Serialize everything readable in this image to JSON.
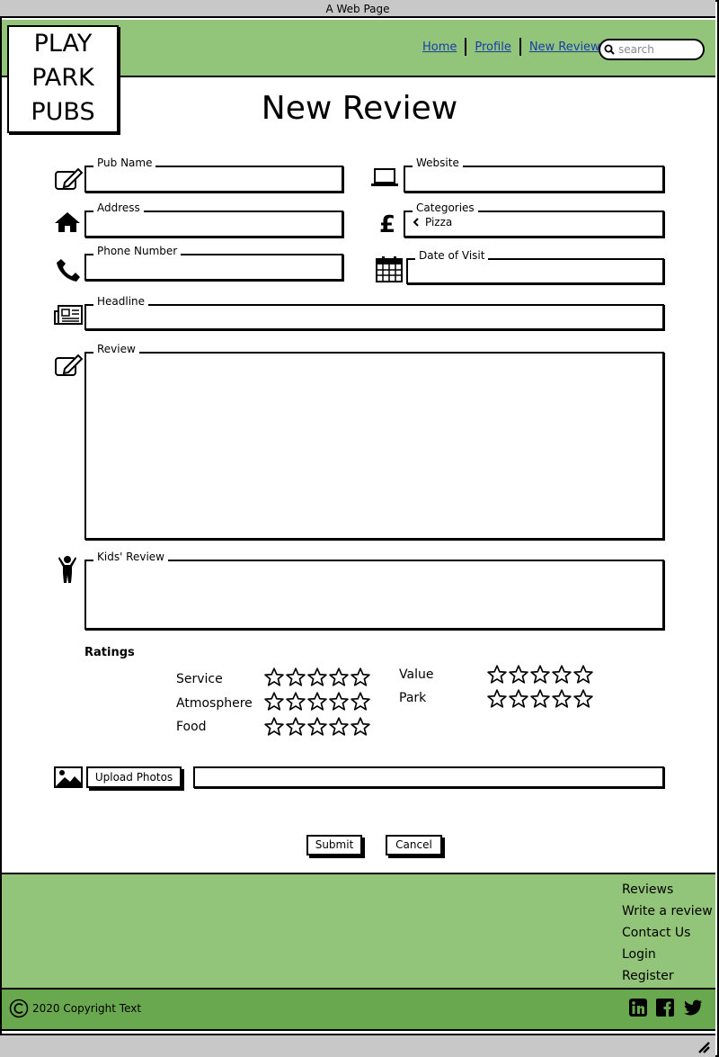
{
  "window": {
    "title": "A Web Page"
  },
  "logo": {
    "line1": "PLAY",
    "line2": "PARK",
    "line3": "PUBS"
  },
  "nav": {
    "home": "Home",
    "profile": "Profile",
    "new_review": "New Review"
  },
  "search": {
    "placeholder": "search"
  },
  "page": {
    "title": "New Review"
  },
  "form": {
    "pub_name": {
      "label": "Pub Name",
      "value": ""
    },
    "website": {
      "label": "Website",
      "value": ""
    },
    "address": {
      "label": "Address",
      "value": ""
    },
    "categories": {
      "label": "Categories",
      "value": "Pizza"
    },
    "phone": {
      "label": "Phone Number",
      "value": ""
    },
    "date_of_visit": {
      "label": "Date of Visit",
      "value": ""
    },
    "headline": {
      "label": "Headline",
      "value": ""
    },
    "review": {
      "label": "Review",
      "value": ""
    },
    "kids_review": {
      "label": "Kids' Review",
      "value": ""
    }
  },
  "ratings": {
    "title": "Ratings",
    "service": {
      "label": "Service",
      "stars": 0
    },
    "atmosphere": {
      "label": "Atmosphere",
      "stars": 0
    },
    "food": {
      "label": "Food",
      "stars": 0
    },
    "value": {
      "label": "Value",
      "stars": 0
    },
    "park": {
      "label": "Park",
      "stars": 0
    }
  },
  "upload": {
    "button_label": "Upload Photos",
    "value": ""
  },
  "actions": {
    "submit": "Submit",
    "cancel": "Cancel"
  },
  "footer": {
    "links": [
      "Reviews",
      "Write a review",
      "Contact Us",
      "Login",
      "Register"
    ],
    "copyright": "2020 Copyright Text"
  },
  "colors": {
    "header_bg": "#92c47a",
    "copyright_bg": "#6aa84f",
    "link": "#1a3ea8",
    "chrome": "#c8c8c8"
  },
  "icons": [
    "edit-icon",
    "laptop-icon",
    "home-icon",
    "pound-icon",
    "phone-icon",
    "calendar-icon",
    "newspaper-icon",
    "child-icon",
    "image-icon",
    "search-icon",
    "star-icon",
    "linkedin-icon",
    "facebook-icon",
    "twitter-icon",
    "copyright-icon",
    "chevron-left-icon"
  ]
}
